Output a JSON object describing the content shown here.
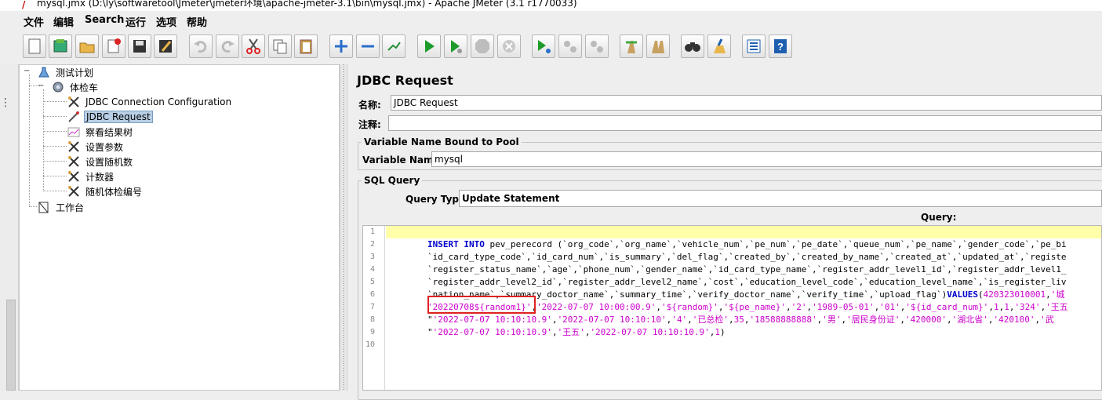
{
  "window": {
    "title": "mysql.jmx (D:\\ly\\softwaretool\\Jmeter\\jmeter环境\\apache-jmeter-3.1\\bin\\mysql.jmx) - Apache JMeter (3.1 r1770033)"
  },
  "menu": {
    "items": [
      {
        "label": "文件"
      },
      {
        "label": "编辑"
      },
      {
        "label": "Search"
      },
      {
        "label": "运行"
      },
      {
        "label": "选项"
      },
      {
        "label": "帮助"
      }
    ]
  },
  "toolbar": {
    "icons": [
      "new-icon",
      "templates-icon",
      "open-icon",
      "close-icon",
      "save-icon",
      "save-as-icon",
      "undo-icon",
      "redo-icon",
      "cut-icon",
      "copy-icon",
      "paste-icon",
      "expand-icon",
      "collapse-icon",
      "toggle-icon",
      "start-icon",
      "start-no-pause-icon",
      "stop-icon",
      "shutdown-icon",
      "remote-start-icon",
      "remote-stop-icon",
      "remote-shutdown-icon",
      "clear-icon",
      "clear-all-icon",
      "search-icon",
      "reset-search-icon",
      "function-helper-icon",
      "help-icon"
    ]
  },
  "tree": {
    "items": [
      {
        "label": "测试计划",
        "icon": "test-plan-icon"
      },
      {
        "label": "体检车",
        "icon": "thread-group-icon"
      },
      {
        "label": "JDBC Connection Configuration",
        "icon": "config-icon"
      },
      {
        "label": "JDBC Request",
        "icon": "sampler-icon"
      },
      {
        "label": "察看结果树",
        "icon": "listener-icon"
      },
      {
        "label": "设置参数",
        "icon": "config-icon"
      },
      {
        "label": "设置随机数",
        "icon": "config-icon"
      },
      {
        "label": "计数器",
        "icon": "config-icon"
      },
      {
        "label": "随机体检编号",
        "icon": "config-icon"
      },
      {
        "label": "工作台",
        "icon": "workbench-icon"
      }
    ],
    "selected_index": 3
  },
  "panel": {
    "title": "JDBC Request",
    "name_label": "名称:",
    "name_value": "JDBC Request",
    "comment_label": "注释:",
    "comment_value": "",
    "pool_group_title": "Variable Name Bound to Pool",
    "variable_name_label": "Variable Name:",
    "variable_name_value": "mysql",
    "sql_group_title": "SQL Query",
    "query_type_label": "Query Type:",
    "query_type_value": "Update Statement",
    "query_label": "Query:"
  },
  "editor": {
    "line_numbers": [
      "1",
      "2",
      "3",
      "4",
      "5",
      "6",
      "7",
      "8",
      "9",
      "10"
    ],
    "lines": [
      "",
      "        INSERT INTO pev_perecord (`org_code`,`org_name`,`vehicle_num`,`pe_num`,`pe_date`,`queue_num`,`pe_name`,`gender_code`,`pe_bi",
      "        `id_card_type_code`,`id_card_num`,`is_summary`,`del_flag`,`created_by`,`created_by_name`,`created_at`,`updated_at`,`registe",
      "        `register_status_name`,`age`,`phone_num`,`gender_name`,`id_card_type_name`,`register_addr_level1_id`,`register_addr_level1_",
      "        `register_addr_level2_id`,`register_addr_level2_name`,`cost`,`education_level_code`,`education_level_name`,`is_register_liv",
      "        `nation_name`,`summary_doctor_name`,`summary_time`,`verify_doctor_name`,`verify_time`,`upload_flag`)VALUES(420323010001,'城",
      "        '20220708${random1}','2022-07-07 10:00:00.9','${random}','${pe_name}','2','1989-05-01','01','${id_card_num}',1,1,'324','王五",
      "        \"'2022-07-07 10:10:10.9','2022-07-07 10:10:10','4','已总检',35,'18588888888','男','居民身份证','420000','湖北省','420100','武",
      "        \"'2022-07-07 10:10:10.9','王五','2022-07-07 10:10:10.9',1)",
      ""
    ]
  },
  "colors": {
    "keyword": "#0000cc",
    "string": "#cc00cc",
    "current_line": "#ffffaa",
    "highlight_box": "#e02020",
    "selection": "#b8cfe5"
  }
}
